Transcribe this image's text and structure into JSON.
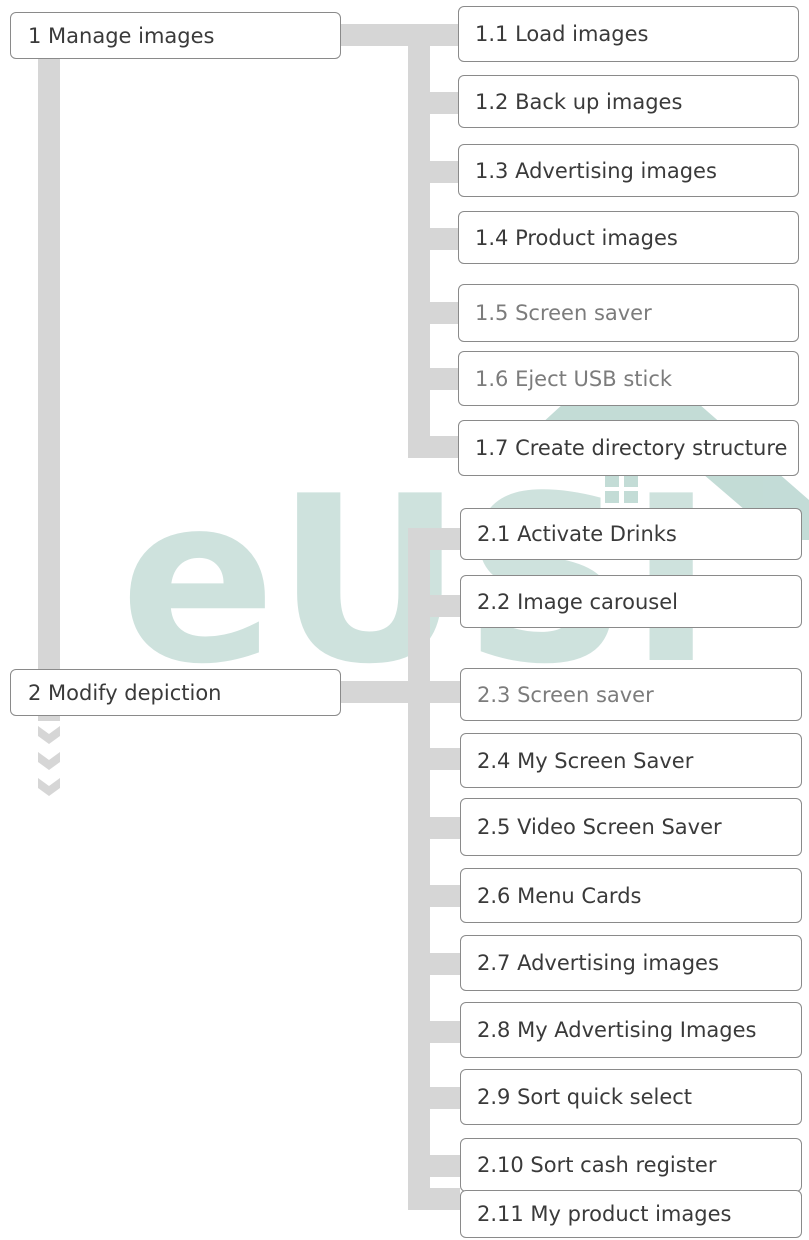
{
  "colors": {
    "connector": "#d6d6d6",
    "box_border": "#8a8a8a",
    "text_dark": "#3a3a3a",
    "text_grey": "#7c7c7c",
    "watermark": "#b9d6d0"
  },
  "watermark": {
    "text": "eUSI",
    "icon": "house-logo"
  },
  "groups": [
    {
      "label": "1 Manage images",
      "items": [
        {
          "label": "1.1 Load images",
          "tone": "dark"
        },
        {
          "label": "1.2 Back up images",
          "tone": "dark"
        },
        {
          "label": "1.3 Advertising images",
          "tone": "dark"
        },
        {
          "label": "1.4 Product images",
          "tone": "dark"
        },
        {
          "label": "1.5 Screen saver",
          "tone": "grey"
        },
        {
          "label": "1.6 Eject USB stick",
          "tone": "grey"
        },
        {
          "label": "1.7 Create directory structure",
          "tone": "dark"
        }
      ]
    },
    {
      "label": "2 Modify depiction",
      "items": [
        {
          "label": "2.1 Activate Drinks",
          "tone": "dark"
        },
        {
          "label": "2.2 Image carousel",
          "tone": "dark"
        },
        {
          "label": "2.3 Screen saver",
          "tone": "grey"
        },
        {
          "label": "2.4 My Screen Saver",
          "tone": "dark"
        },
        {
          "label": "2.5 Video Screen Saver",
          "tone": "dark"
        },
        {
          "label": "2.6 Menu Cards",
          "tone": "dark"
        },
        {
          "label": "2.7 Advertising images",
          "tone": "dark"
        },
        {
          "label": "2.8 My Advertising Images",
          "tone": "dark"
        },
        {
          "label": "2.9 Sort quick select",
          "tone": "dark"
        },
        {
          "label": "2.10 Sort cash register",
          "tone": "dark"
        },
        {
          "label": "2.11 My product images",
          "tone": "dark"
        }
      ]
    }
  ]
}
